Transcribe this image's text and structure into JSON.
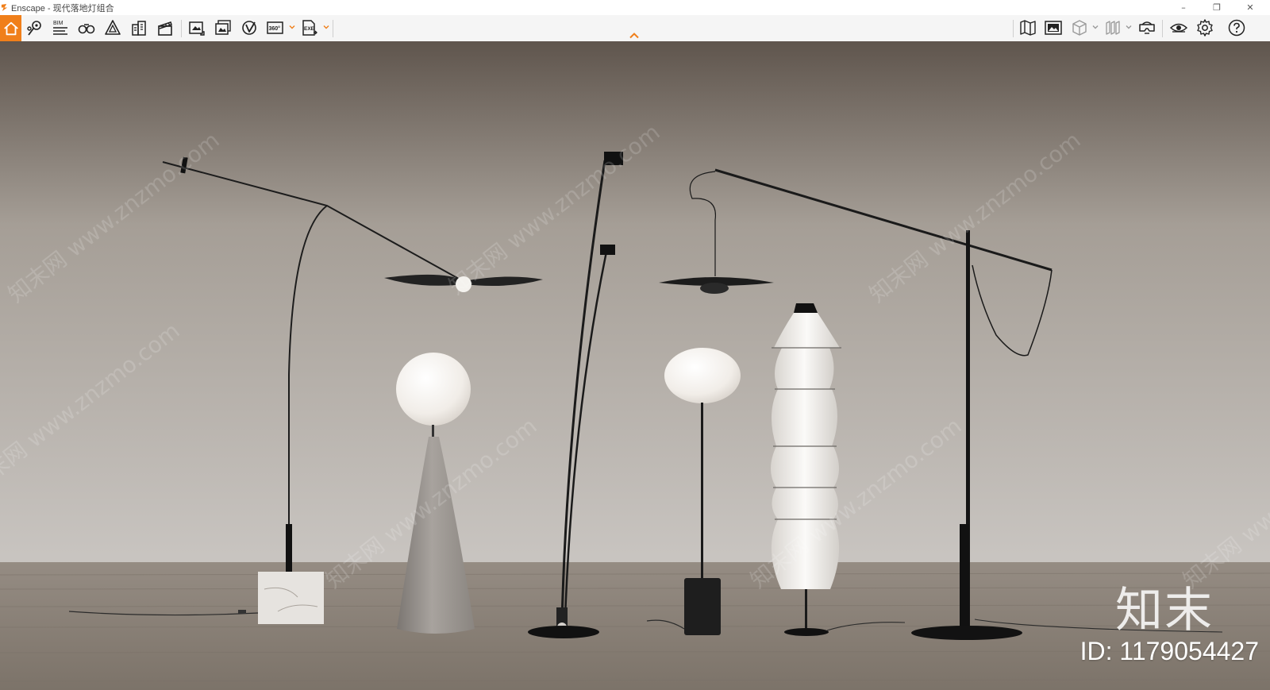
{
  "window": {
    "title": "Enscape - 现代落地灯组合",
    "controls": {
      "minimize": "–",
      "restore": "❐",
      "close": "✕"
    }
  },
  "toolbar": {
    "accent_color": "#f07f1a",
    "left_tools": [
      {
        "name": "home-icon",
        "label": "Home"
      },
      {
        "name": "views-icon",
        "label": "Views"
      },
      {
        "name": "bim-icon",
        "label": "BIM"
      },
      {
        "name": "binoculars-icon",
        "label": "Walk / Fly"
      },
      {
        "name": "asset-library-icon",
        "label": "Asset Library"
      },
      {
        "name": "buildings-icon",
        "label": "Objects"
      },
      {
        "name": "clapboard-icon",
        "label": "Video Editor"
      },
      {
        "name": "screenshot-icon",
        "label": "Render Image"
      },
      {
        "name": "batch-render-icon",
        "label": "Batch Render"
      },
      {
        "name": "vr-icon",
        "label": "Export VR"
      },
      {
        "name": "panorama-360-icon",
        "label": "360"
      },
      {
        "name": "export-exe-icon",
        "label": "EXE"
      }
    ],
    "bim_text": "BIM",
    "pano_text": "360°",
    "exe_text": "EXE",
    "right_tools": [
      {
        "name": "map-icon",
        "label": "Map"
      },
      {
        "name": "gallery-icon",
        "label": "Gallery"
      },
      {
        "name": "cube-icon",
        "label": "View Mode"
      },
      {
        "name": "sections-icon",
        "label": "Sections"
      },
      {
        "name": "vr-headset-icon",
        "label": "VR Headset"
      },
      {
        "name": "eye-icon",
        "label": "Visual Settings"
      },
      {
        "name": "gear-icon",
        "label": "General Settings"
      },
      {
        "name": "help-icon",
        "label": "Help"
      }
    ]
  },
  "viewport": {
    "watermark_text": "知末网 www.znzmo.com",
    "brand_mark": "知末",
    "asset_id": "ID: 1179054427",
    "scene_colors": {
      "wall_top": "#5f554d",
      "wall_mid": "#a59e96",
      "wall_bottom": "#c9c5c1",
      "floor": "#8e857c"
    }
  }
}
